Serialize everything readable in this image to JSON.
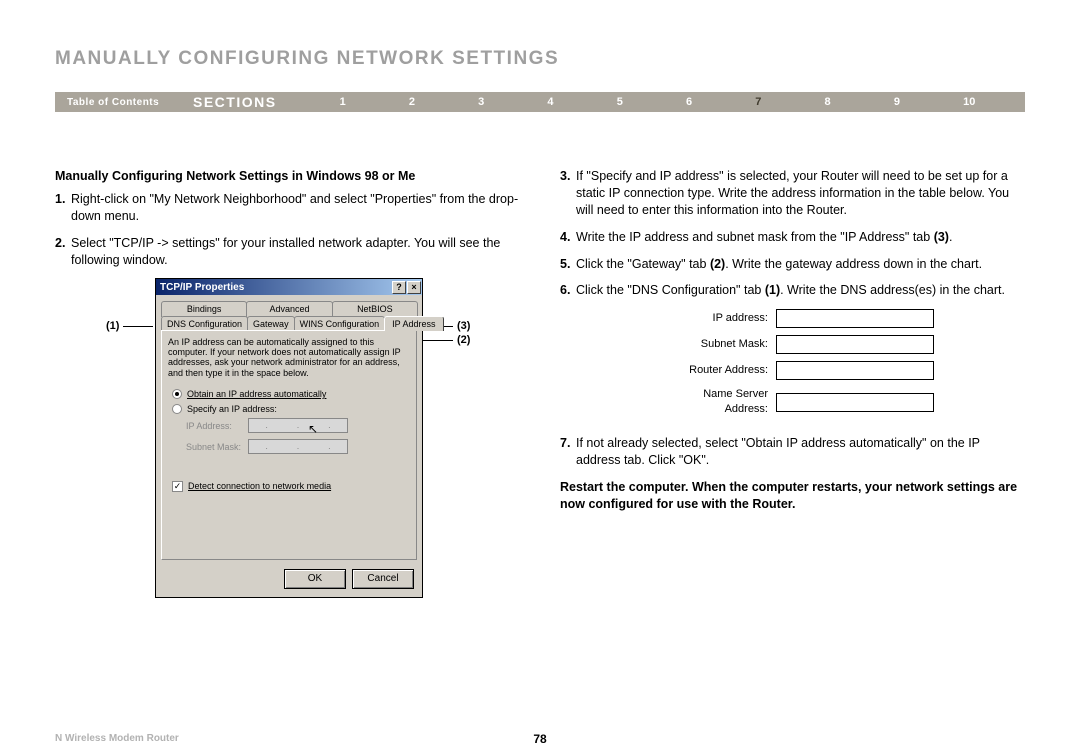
{
  "title": "MANUALLY CONFIGURING NETWORK SETTINGS",
  "nav": {
    "toc": "Table of Contents",
    "sections": "SECTIONS",
    "nums": [
      "1",
      "2",
      "3",
      "4",
      "5",
      "6",
      "7",
      "8",
      "9",
      "10"
    ],
    "active": "7"
  },
  "left": {
    "subhead": "Manually Configuring Network Settings in Windows 98 or Me",
    "s1n": "1.",
    "s1": "Right-click on \"My Network Neighborhood\" and select \"Properties\" from the drop-down menu.",
    "s2n": "2.",
    "s2": "Select \"TCP/IP -> settings\" for your installed network adapter. You will see the following window."
  },
  "dialog": {
    "title": "TCP/IP Properties",
    "help": "?",
    "close": "×",
    "tabs_r1": [
      "Bindings",
      "Advanced",
      "NetBIOS"
    ],
    "tabs_r2": [
      "DNS Configuration",
      "Gateway",
      "WINS Configuration",
      "IP Address"
    ],
    "desc": "An IP address can be automatically assigned to this computer. If your network does not automatically assign IP addresses, ask your network administrator for an address, and then type it in the space below.",
    "r1": "Obtain an IP address automatically",
    "r2": "Specify an IP address:",
    "ip_lbl": "IP Address:",
    "sm_lbl": "Subnet Mask:",
    "dot": ".",
    "chk_mark": "✓",
    "chk": "Detect connection to network media",
    "ok": "OK",
    "cancel": "Cancel",
    "c1": "(1)",
    "c2": "(2)",
    "c3": "(3)",
    "cursor": "↖"
  },
  "right": {
    "s3n": "3.",
    "s3": "If \"Specify and IP address\" is selected, your Router will need to be set up for a static IP connection type. Write the address information in the table below. You will need to enter this information into the Router.",
    "s4n": "4.",
    "s4a": "Write the IP address and subnet mask from the \"IP Address\" tab ",
    "s4b": "(3)",
    "s4c": ".",
    "s5n": "5.",
    "s5a": "Click the \"Gateway\" tab ",
    "s5b": "(2)",
    "s5c": ". Write the gateway address down in the chart.",
    "s6n": "6.",
    "s6a": "Click the \"DNS Configuration\" tab ",
    "s6b": "(1)",
    "s6c": ". Write the DNS address(es) in the chart.",
    "s7n": "7.",
    "s7": "If not already selected, select \"Obtain IP address automatically\" on the IP address tab. Click \"OK\".",
    "restart": "Restart the computer. When the computer restarts, your network settings are now configured for use with the Router.",
    "form": {
      "f1": "IP address:",
      "f2": "Subnet Mask:",
      "f3": "Router Address:",
      "f4": "Name Server Address:"
    }
  },
  "footer": {
    "product": "N Wireless Modem Router",
    "page": "78"
  }
}
